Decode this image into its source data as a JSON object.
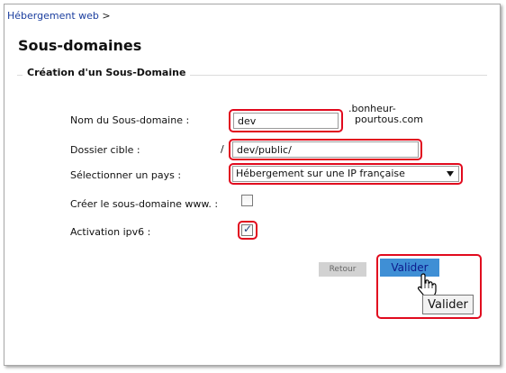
{
  "breadcrumb": {
    "link": "Hébergement web",
    "separator": ">"
  },
  "page": {
    "title": "Sous-domaines"
  },
  "section": {
    "title": "Création d'un Sous-Domaine"
  },
  "form": {
    "subdomain": {
      "label": "Nom du Sous-domaine :",
      "value": "dev",
      "suffix_line1": ".bonheur-",
      "suffix_line2": "pourtous.com"
    },
    "target": {
      "label": "Dossier cible :",
      "prefix": "/",
      "value": "dev/public/"
    },
    "country": {
      "label": "Sélectionner un pays :",
      "selected": "Hébergement sur une IP française"
    },
    "www": {
      "label": "Créer le sous-domaine www. :",
      "checked": false
    },
    "ipv6": {
      "label": "Activation ipv6 :",
      "checked": true
    }
  },
  "buttons": {
    "back": "Retour",
    "submit": "Valider"
  },
  "tooltip": {
    "text": "Valider"
  },
  "colors": {
    "highlight": "#e10a1e",
    "submit_bg": "#3f8fd5",
    "submit_text": "#0c1a8c",
    "link": "#1a3d9e"
  },
  "icons": {
    "cursor": "hand-pointer-icon",
    "dropdown": "caret-down-icon",
    "check": "checkmark-icon"
  }
}
